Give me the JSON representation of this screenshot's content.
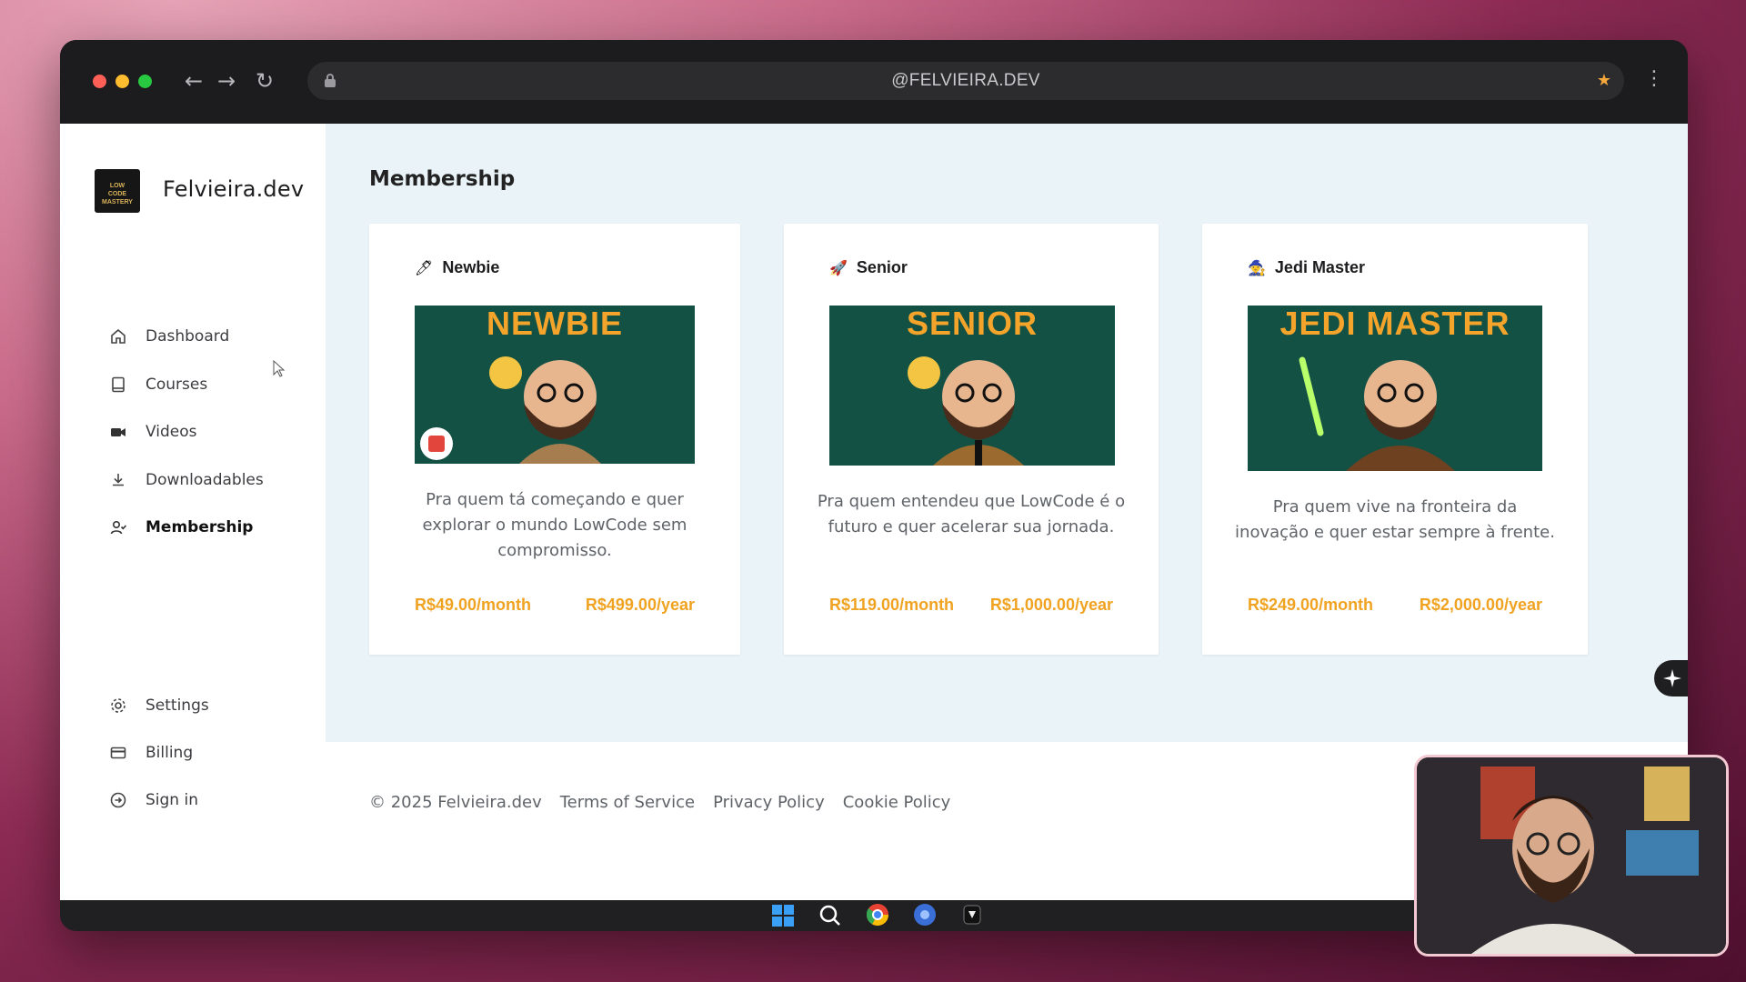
{
  "browser": {
    "url": "@FELVIEIRA.DEV",
    "icons": [
      "back-arrow",
      "forward-arrow",
      "reload",
      "lock",
      "star",
      "more-vertical"
    ]
  },
  "sidebar": {
    "logo_text": "LOW CODE MASTERY",
    "brand": "Felvieira.dev",
    "items": [
      {
        "label": "Dashboard",
        "icon": "home-icon"
      },
      {
        "label": "Courses",
        "icon": "book-icon"
      },
      {
        "label": "Videos",
        "icon": "video-icon"
      },
      {
        "label": "Downloadables",
        "icon": "download-icon"
      },
      {
        "label": "Membership",
        "icon": "user-check-icon",
        "active": true
      }
    ],
    "bottom_items": [
      {
        "label": "Settings",
        "icon": "gear-icon"
      },
      {
        "label": "Billing",
        "icon": "credit-card-icon"
      },
      {
        "label": "Sign in",
        "icon": "sign-in-icon"
      }
    ]
  },
  "main": {
    "title": "Membership",
    "plans": [
      {
        "emoji": "🖊",
        "name": "Newbie",
        "banner": "NEWBIE",
        "description": "Pra quem tá começando e quer explorar o mundo LowCode sem compromisso.",
        "price_month": "R$49.00/month",
        "price_year": "R$499.00/year"
      },
      {
        "emoji": "🚀",
        "name": "Senior",
        "banner": "SENIOR",
        "description": "Pra quem entendeu que LowCode é o futuro e quer acelerar sua jornada.",
        "price_month": "R$119.00/month",
        "price_year": "R$1,000.00/year"
      },
      {
        "emoji": "🧙",
        "name": "Jedi Master",
        "banner": "JEDI MASTER",
        "description": "Pra quem vive na fronteira da inovação e quer estar sempre à frente.",
        "price_month": "R$249.00/month",
        "price_year": "R$2,000.00/year"
      }
    ]
  },
  "footer": {
    "copyright": "© 2025 Felvieira.dev",
    "links": [
      "Terms of Service",
      "Privacy Policy",
      "Cookie Policy"
    ]
  },
  "colors": {
    "accent_price": "#f0a321",
    "main_bg": "#eaf4f8",
    "card_image_bg": "#135144"
  }
}
